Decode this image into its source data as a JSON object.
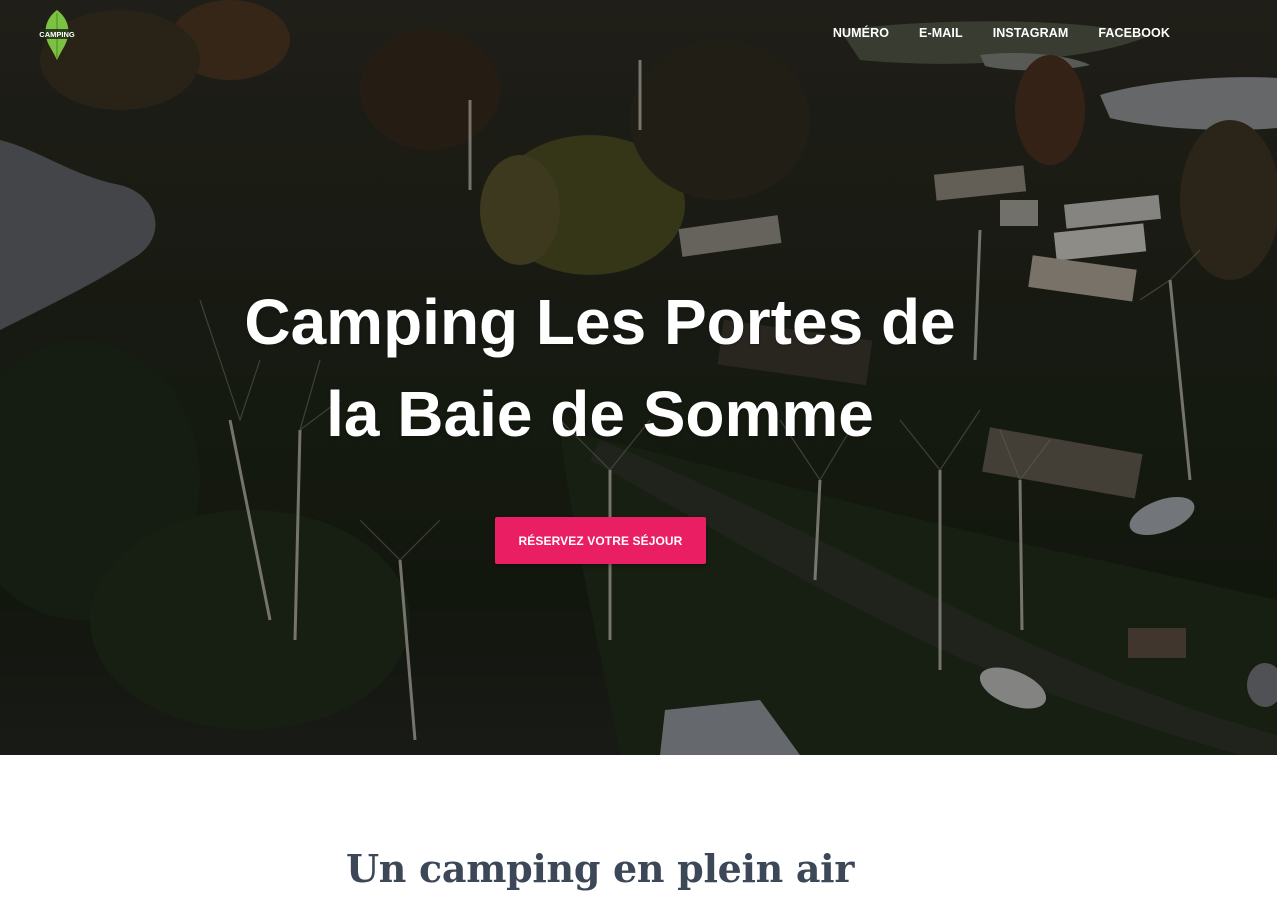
{
  "brand": {
    "logo_text": "CAMPING",
    "logo_icon": "leaf-icon",
    "accent_color": "#e91e63",
    "logo_color": "#7cc242"
  },
  "nav": {
    "items": [
      {
        "label": "NUMÉRO"
      },
      {
        "label": "E-MAIL"
      },
      {
        "label": "INSTAGRAM"
      },
      {
        "label": "FACEBOOK"
      }
    ]
  },
  "hero": {
    "title_line1": "Camping Les Portes de",
    "title_line2": "la Baie de Somme",
    "cta_label": "RÉSERVEZ VOTRE SÉJOUR"
  },
  "section": {
    "title": "Un camping en plein air"
  }
}
